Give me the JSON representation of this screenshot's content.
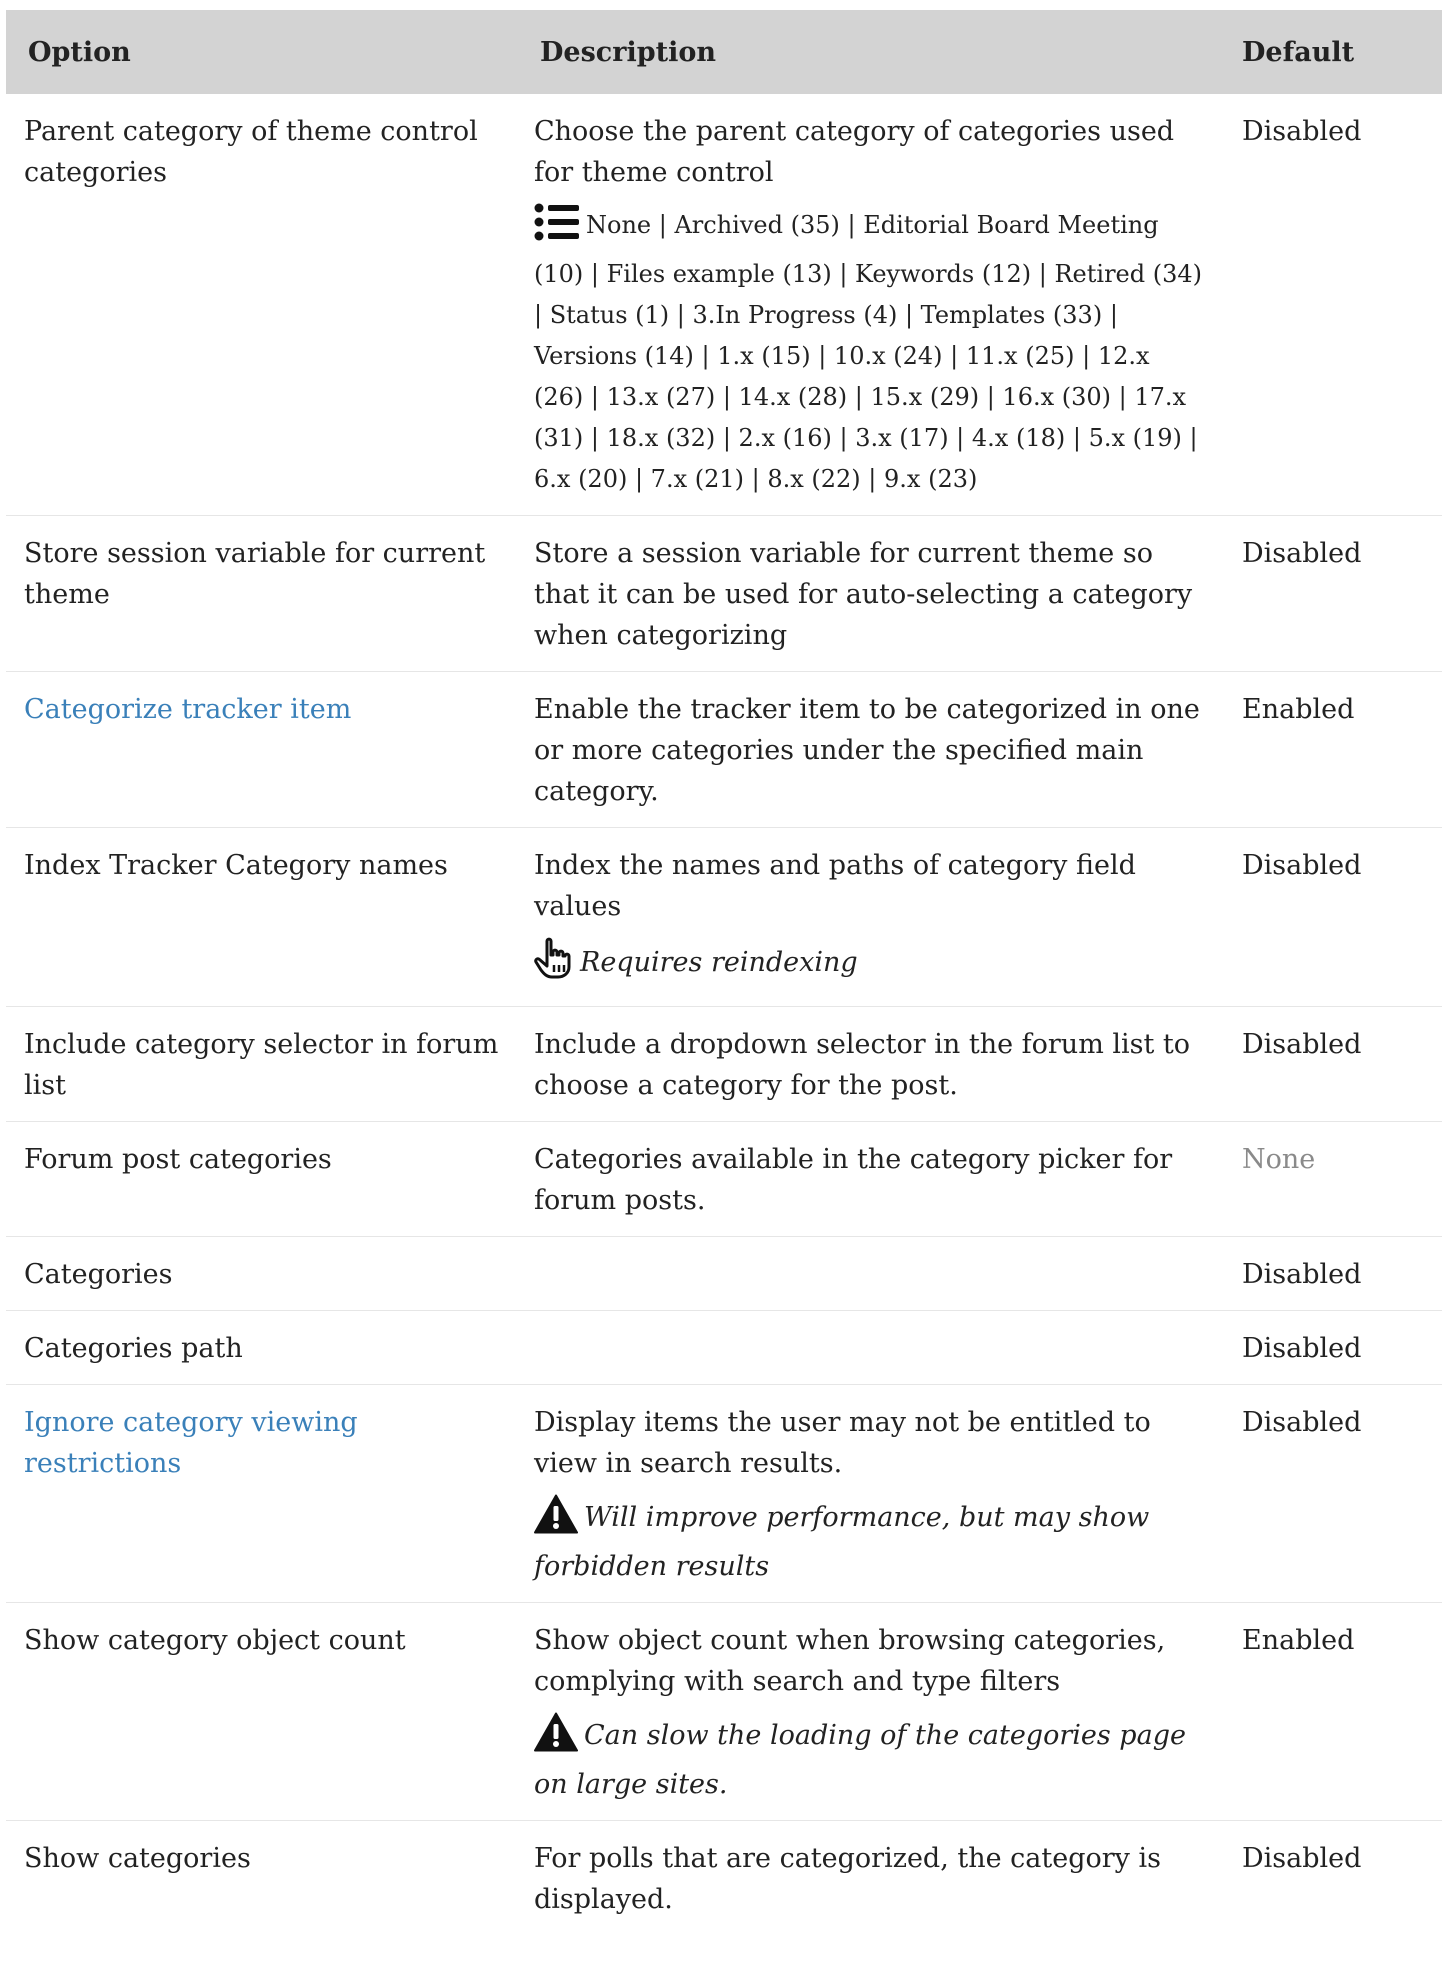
{
  "table": {
    "headers": {
      "option": "Option",
      "description": "Description",
      "default": "Default"
    },
    "rows": [
      {
        "option": "Parent category of theme control categories",
        "description": "Choose the parent category of categories used for theme control",
        "values_list": "None | Archived (35) | Editorial Board Meeting (10) | Files example (13) | Keywords (12) | Retired (34) | Status (1) | 3.In Progress (4) | Templates (33) | Versions (14) | 1.x (15) | 10.x (24) | 11.x (25) | 12.x (26) | 13.x (27) | 14.x (28) | 15.x (29) | 16.x (30) | 17.x (31) | 18.x (32) | 2.x (16) | 3.x (17) | 4.x (18) | 5.x (19) | 6.x (20) | 7.x (21) | 8.x (22) | 9.x (23)",
        "default": "Disabled"
      },
      {
        "option": "Store session variable for current theme",
        "description": "Store a session variable for current theme so that it can be used for auto-selecting a category when categorizing",
        "default": "Disabled"
      },
      {
        "option": "Categorize tracker item",
        "description": "Enable the tracker item to be categorized in one or more categories under the specified main category.",
        "default": "Enabled"
      },
      {
        "option": "Index Tracker Category names",
        "description": "Index the names and paths of category field values",
        "note": "Requires reindexing",
        "default": "Disabled"
      },
      {
        "option": "Include category selector in forum list",
        "description": "Include a dropdown selector in the forum list to choose a category for the post.",
        "default": "Disabled"
      },
      {
        "option": "Forum post categories",
        "description": "Categories available in the category picker for forum posts.",
        "default": "None"
      },
      {
        "option": "Categories",
        "description": "",
        "default": "Disabled"
      },
      {
        "option": "Categories path",
        "description": "",
        "default": "Disabled"
      },
      {
        "option": "Ignore category viewing restrictions",
        "description": "Display items the user may not be entitled to view in search results.",
        "note": "Will improve performance, but may show forbidden results",
        "default": "Disabled"
      },
      {
        "option": "Show category object count",
        "description": "Show object count when browsing categories, complying with search and type filters",
        "note": "Can slow the loading of the categories page on large sites.",
        "default": "Enabled"
      },
      {
        "option": "Show categories",
        "description": "For polls that are categorized, the category is displayed.",
        "default": "Disabled"
      }
    ]
  },
  "icons": {
    "values_list": "list-icon",
    "reindex": "pointing-hand-icon",
    "warning": "warning-triangle-icon"
  },
  "colors": {
    "header_bg": "#d3d3d3",
    "link": "#3a80b9",
    "muted": "#8a8a8a",
    "text": "#222222"
  }
}
